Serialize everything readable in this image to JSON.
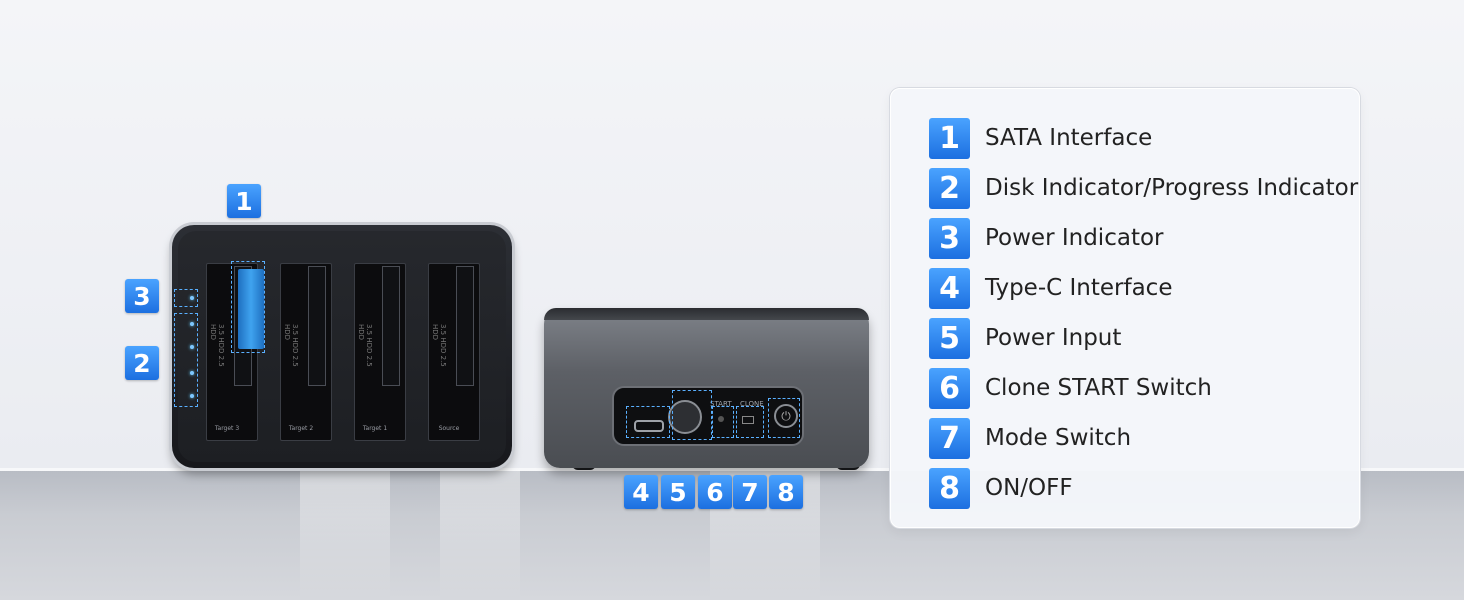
{
  "legend": {
    "items": [
      {
        "num": "1",
        "label": "SATA Interface"
      },
      {
        "num": "2",
        "label": "Disk Indicator/Progress Indicator"
      },
      {
        "num": "3",
        "label": "Power Indicator"
      },
      {
        "num": "4",
        "label": "Type-C Interface"
      },
      {
        "num": "5",
        "label": "Power Input"
      },
      {
        "num": "6",
        "label": "Clone START Switch"
      },
      {
        "num": "7",
        "label": "Mode Switch"
      },
      {
        "num": "8",
        "label": "ON/OFF"
      }
    ]
  },
  "callouts": {
    "sata": "1",
    "disk_indicator": "2",
    "power_indicator": "3",
    "rear": [
      "4",
      "5",
      "6",
      "7",
      "8"
    ]
  },
  "dock": {
    "slot_text": "3.5 HDD  2.5 HDD",
    "slot_labels": [
      "Target 3",
      "Target 2",
      "Target 1",
      "Source"
    ],
    "rear_labels": {
      "start": "START",
      "clone": "CLONE"
    }
  },
  "colors": {
    "badge": "#2f86f0",
    "accent_led": "#7ec8ff"
  }
}
